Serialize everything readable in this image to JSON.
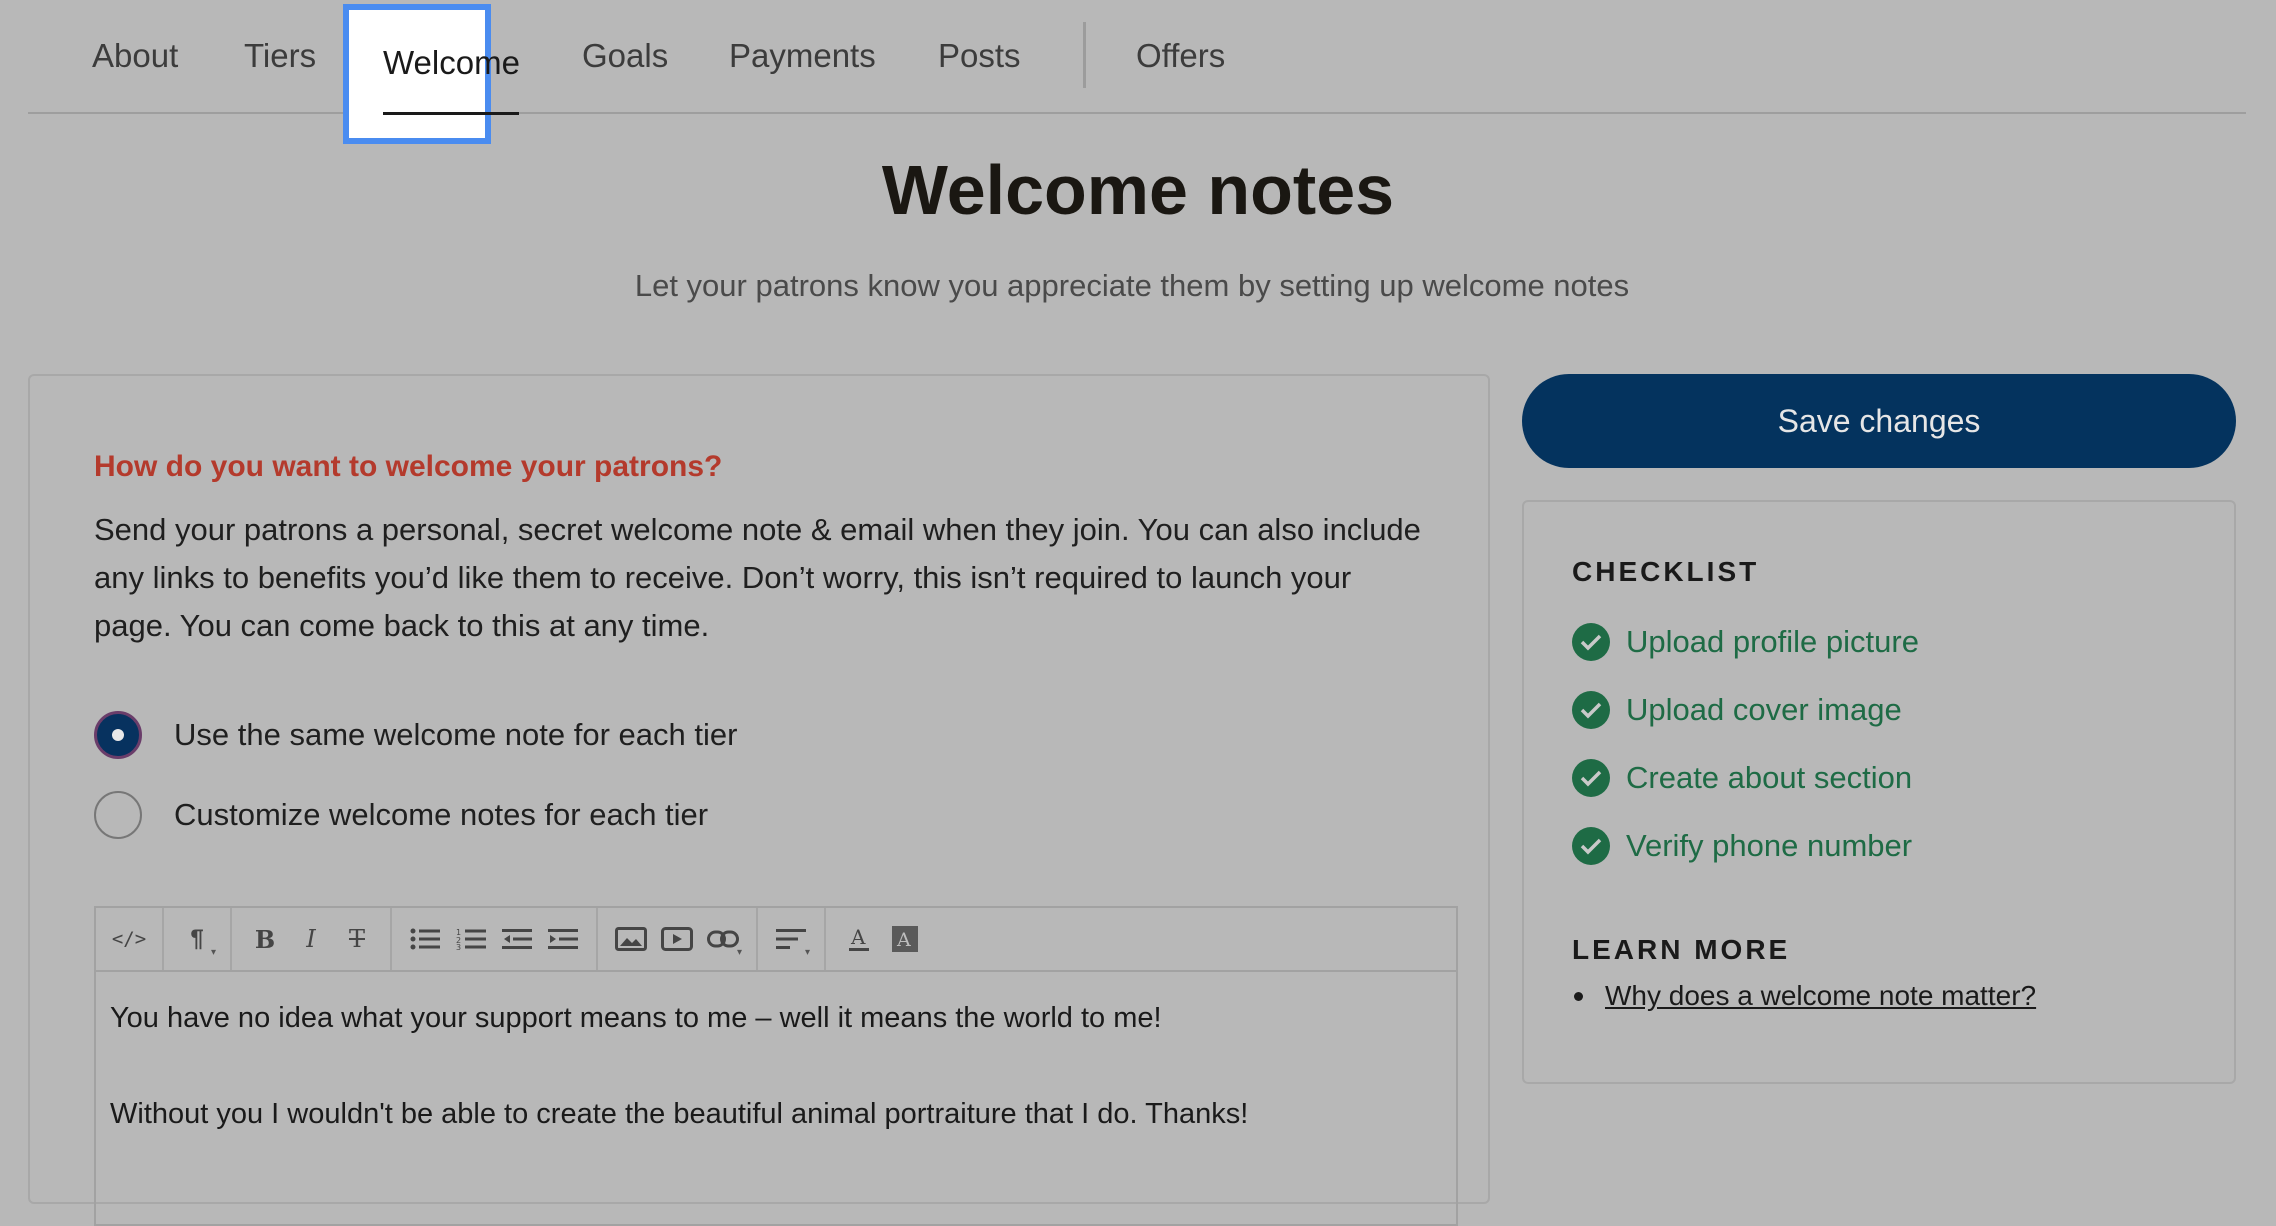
{
  "tabs": {
    "about": "About",
    "tiers": "Tiers",
    "welcome": "Welcome",
    "goals": "Goals",
    "payments": "Payments",
    "posts": "Posts",
    "offers": "Offers",
    "active": "Welcome"
  },
  "header": {
    "title": "Welcome notes",
    "subtitle": "Let your patrons know you appreciate them by setting up welcome notes"
  },
  "form": {
    "question": "How do you want to welcome your patrons?",
    "description": "Send your patrons a personal, secret welcome note & email when they join. You can also include any links to benefits you’d like them to receive. Don’t worry, this isn’t required to launch your page. You can come back to this at any time.",
    "options": [
      {
        "label": "Use the same welcome note for each tier",
        "selected": true
      },
      {
        "label": "Customize welcome notes for each tier",
        "selected": false
      }
    ]
  },
  "editor": {
    "toolbar": [
      "code-view",
      "paragraph",
      "bold",
      "italic",
      "strikethrough",
      "bulleted-list",
      "numbered-list",
      "outdent",
      "indent",
      "image",
      "video",
      "link",
      "align",
      "text-color",
      "highlight"
    ],
    "paragraphs": [
      "You have no idea what your support means to me – well it means the world to me!",
      "Without you I wouldn't be able to create the beautiful animal portraiture that I do. Thanks!"
    ]
  },
  "sidebar": {
    "save_label": "Save changes",
    "checklist_title": "CHECKLIST",
    "checklist": [
      "Upload profile picture",
      "Upload cover image",
      "Create about section",
      "Verify phone number"
    ],
    "learn_more_title": "LEARN MORE",
    "learn_more_link": "Why does a welcome note matter?"
  },
  "colors": {
    "accent_navy": "#04335e",
    "question_red": "#b43a2c",
    "check_green": "#1e6b45",
    "focus_blue": "#4a8cf0"
  }
}
